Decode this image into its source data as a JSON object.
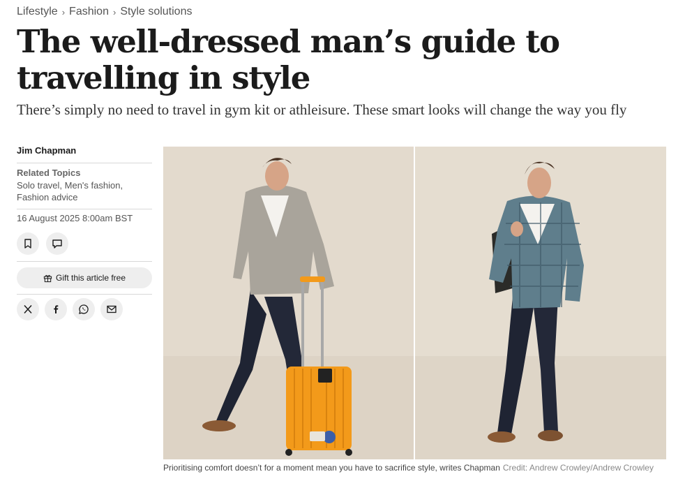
{
  "breadcrumb": {
    "items": [
      "Lifestyle",
      "Fashion",
      "Style solutions"
    ],
    "separator": "›"
  },
  "article": {
    "headline": "The well-dressed man’s guide to travelling in style",
    "standfirst": "There’s simply no need to travel in gym kit or athleisure. These smart looks will change the way you fly"
  },
  "sidebar": {
    "author": "Jim Chapman",
    "topics_title": "Related Topics",
    "topics": "Solo travel, Men's fashion, Fashion advice",
    "date": "16 August 2025 8:00am BST",
    "save_icon": "bookmark-icon",
    "comment_icon": "comment-icon",
    "gift_label": "Gift this article free",
    "share_icons": [
      "x-icon",
      "facebook-icon",
      "whatsapp-icon",
      "email-icon"
    ]
  },
  "image": {
    "caption": "Prioritising comfort doesn’t for a moment mean you have to sacrifice style, writes Chapman",
    "credit": "Credit: Andrew Crowley/Andrew Crowley"
  },
  "colors": {
    "background": "#ffffff",
    "text": "#1a1a1a",
    "muted": "#555555",
    "button_bg": "#eeeeee",
    "suitcase": "#f39a1a"
  }
}
